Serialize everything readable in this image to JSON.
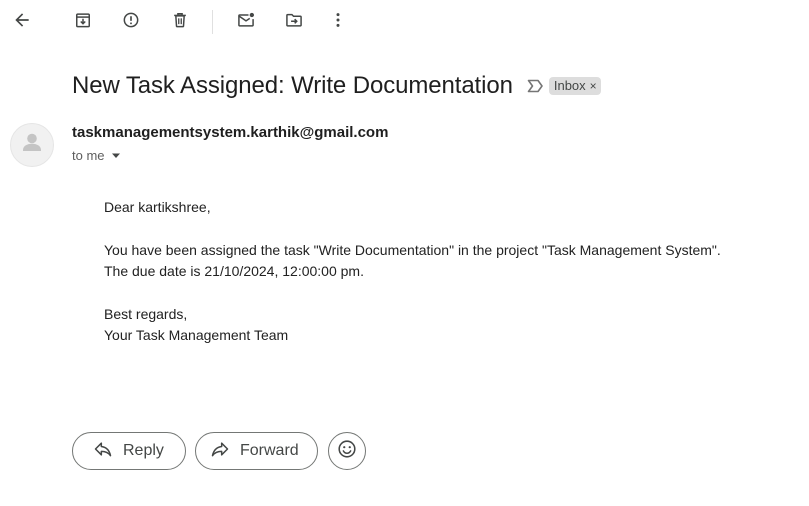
{
  "toolbar": {
    "icons": [
      "back-arrow-icon",
      "archive-icon",
      "report-spam-icon",
      "delete-icon",
      "mark-unread-icon",
      "move-to-icon",
      "more-vert-icon"
    ]
  },
  "email": {
    "subject": "New Task Assigned: Write Documentation",
    "label": "Inbox",
    "label_remove": "×",
    "sender": "taskmanagementsystem.karthik@gmail.com",
    "recipient": "to me",
    "body": {
      "greeting": "Dear kartikshree,",
      "line1": "You have been assigned the task \"Write Documentation\" in the project \"Task Management System\".",
      "line2": "The due date is 21/10/2024, 12:00:00 pm.",
      "closing": "Best regards,",
      "signature": "Your Task Management Team"
    }
  },
  "actions": {
    "reply": "Reply",
    "forward": "Forward"
  },
  "colors": {
    "icon": "#444746",
    "chip_bg": "#dddddd",
    "border": "#747775"
  }
}
